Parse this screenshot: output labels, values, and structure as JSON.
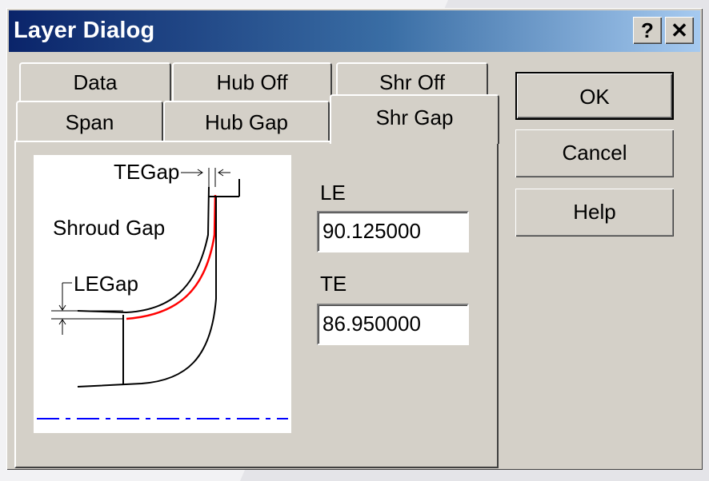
{
  "window": {
    "title": "Layer Dialog",
    "help_label": "?",
    "close_label": "✕"
  },
  "tabs": {
    "row_back": [
      "Data",
      "Hub Off",
      "Shr Off"
    ],
    "row_front": [
      "Span",
      "Hub Gap",
      "Shr Gap"
    ],
    "active": "Shr Gap"
  },
  "diagram": {
    "shroud_gap_label": "Shroud Gap",
    "tegap_label": "TEGap",
    "legap_label": "LEGap",
    "highlight_color": "#ff0000",
    "axis_color": "#0000ff"
  },
  "fields": {
    "le_label": "LE",
    "le_value": "90.125000",
    "te_label": "TE",
    "te_value": "86.950000"
  },
  "buttons": {
    "ok": "OK",
    "cancel": "Cancel",
    "help": "Help"
  }
}
